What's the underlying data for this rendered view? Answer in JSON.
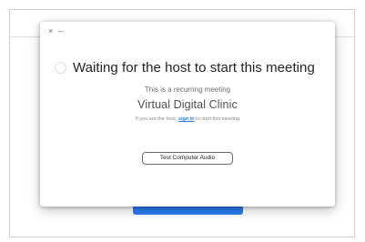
{
  "window_controls": {
    "close_symbol": "×",
    "minimize_symbol": "–"
  },
  "dialog": {
    "heading": "Waiting for the host to start this meeting",
    "recurring_text": "This is a recurring meeting",
    "meeting_topic": "Virtual Digital Clinic",
    "host_prompt_before": "If you are the host, ",
    "sign_in_link": "sign in",
    "host_prompt_after": " to start this meeting",
    "test_audio_button": "Test Computer Audio"
  },
  "icons": [
    "close-icon",
    "minimize-icon",
    "loading-spinner-icon"
  ],
  "colors": {
    "accent": "#2a7df3",
    "text_dark": "#232323",
    "text_muted": "#6d6d6d"
  }
}
